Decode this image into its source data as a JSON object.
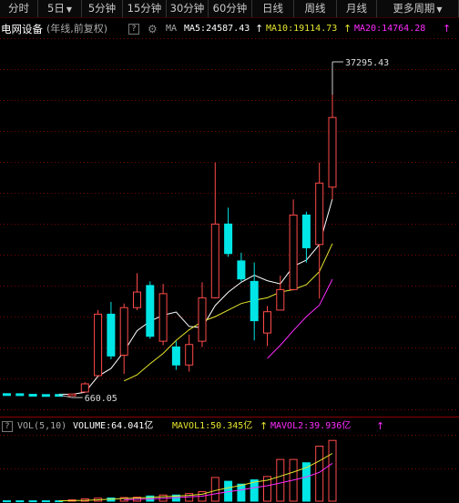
{
  "tabs": [
    {
      "label": "分时",
      "dropdown": false
    },
    {
      "label": "5日",
      "dropdown": true
    },
    {
      "label": "5分钟",
      "dropdown": false
    },
    {
      "label": "15分钟",
      "dropdown": false
    },
    {
      "label": "30分钟",
      "dropdown": false
    },
    {
      "label": "60分钟",
      "dropdown": false
    },
    {
      "label": "日线",
      "dropdown": false
    },
    {
      "label": "周线",
      "dropdown": false
    },
    {
      "label": "月线",
      "dropdown": false
    },
    {
      "label": "更多周期",
      "dropdown": true
    }
  ],
  "legend": {
    "title": "电网设备",
    "subtitle": "(年线,前复权)",
    "help": "?",
    "ma_label": "MA",
    "ma5": "MA5:24587.43",
    "ma10": "MA10:19114.73",
    "ma20": "MA20:14764.28",
    "up_arrow": "↑"
  },
  "price_labels": {
    "high": "37295.43",
    "low": "660.05"
  },
  "volume_legend": {
    "title": "VOL(5,10)",
    "volume": "VOLUME:64.041亿",
    "mavol1": "MAVOL1:50.345亿",
    "mavol2": "MAVOL2:39.936亿",
    "up_arrow": "↑"
  },
  "colors": {
    "up": "#ff4a4a",
    "down": "#00e5e5",
    "ma5": "#ffffff",
    "ma10": "#e6e62e",
    "ma20": "#ff2cff",
    "grid": "#7a0000"
  },
  "chart_data": {
    "type": "candlestick",
    "title": "电网设备",
    "series": [
      {
        "open": 800,
        "close": 760,
        "high": 820,
        "low": 740
      },
      {
        "open": 790,
        "close": 730,
        "high": 800,
        "low": 710
      },
      {
        "open": 720,
        "close": 690,
        "high": 730,
        "low": 680
      },
      {
        "open": 690,
        "close": 680,
        "high": 700,
        "low": 670
      },
      {
        "open": 700,
        "close": 660,
        "high": 710,
        "low": 660.05
      },
      {
        "open": 700,
        "close": 760,
        "high": 780,
        "low": 690
      },
      {
        "open": 1000,
        "close": 2000,
        "high": 2200,
        "low": 900
      },
      {
        "open": 3000,
        "close": 10500,
        "high": 11000,
        "low": 2900
      },
      {
        "open": 10500,
        "close": 5400,
        "high": 12000,
        "low": 5000
      },
      {
        "open": 5500,
        "close": 11300,
        "high": 11800,
        "low": 3200
      },
      {
        "open": 11300,
        "close": 13200,
        "high": 15500,
        "low": 11000
      },
      {
        "open": 14000,
        "close": 7800,
        "high": 14500,
        "low": 7500
      },
      {
        "open": 7200,
        "close": 13000,
        "high": 14200,
        "low": 6700
      },
      {
        "open": 6500,
        "close": 4300,
        "high": 7200,
        "low": 3700
      },
      {
        "open": 4300,
        "close": 6800,
        "high": 8000,
        "low": 3500
      },
      {
        "open": 7200,
        "close": 12500,
        "high": 14400,
        "low": 6500
      },
      {
        "open": 12500,
        "close": 21500,
        "high": 29000,
        "low": 12400
      },
      {
        "open": 21500,
        "close": 17900,
        "high": 23500,
        "low": 17500
      },
      {
        "open": 17000,
        "close": 14800,
        "high": 18000,
        "low": 14500
      },
      {
        "open": 14500,
        "close": 9700,
        "high": 16800,
        "low": 7300
      },
      {
        "open": 8200,
        "close": 10800,
        "high": 11500,
        "low": 6600
      },
      {
        "open": 11000,
        "close": 13500,
        "high": 15200,
        "low": 11000
      },
      {
        "open": 13500,
        "close": 22600,
        "high": 24500,
        "low": 13400
      },
      {
        "open": 22600,
        "close": 18600,
        "high": 23000,
        "low": 16800
      },
      {
        "open": 19000,
        "close": 26500,
        "high": 29000,
        "low": 12400
      },
      {
        "open": 26000,
        "close": 34500,
        "high": 37295.43,
        "low": 24500
      }
    ],
    "ma5": [
      null,
      null,
      null,
      null,
      742,
      724,
      966,
      2926,
      3876,
      5952,
      8480,
      9640,
      10380,
      10760,
      9000,
      8860,
      11560,
      13180,
      14400,
      15260,
      14580,
      14200,
      16340,
      17100,
      19000,
      24587.43
    ],
    "ma10": [
      null,
      null,
      null,
      null,
      null,
      null,
      null,
      null,
      null,
      2350,
      3100,
      4450,
      5700,
      7300,
      8600,
      9600,
      10200,
      11000,
      11800,
      12200,
      12500,
      13200,
      13500,
      14100,
      15700,
      19114.73
    ],
    "ma20": [
      null,
      null,
      null,
      null,
      null,
      null,
      null,
      null,
      null,
      null,
      null,
      null,
      null,
      null,
      null,
      null,
      null,
      null,
      null,
      null,
      5100,
      6700,
      8500,
      10200,
      11600,
      14764.28
    ],
    "volume": [
      0.4,
      0.4,
      0.4,
      0.4,
      0.4,
      1.5,
      2.5,
      3.2,
      3.4,
      3.8,
      4.2,
      5.5,
      6.5,
      6.5,
      8.0,
      10.0,
      25.0,
      21.0,
      18.0,
      22.5,
      26.0,
      44.0,
      44.0,
      40.5,
      58.0,
      64.041
    ],
    "mavol1": [
      null,
      null,
      null,
      null,
      0.4,
      0.6,
      0.8,
      1.4,
      2.1,
      2.9,
      3.4,
      4.0,
      4.7,
      5.4,
      6.1,
      7.3,
      11.2,
      14.1,
      16.7,
      20.1,
      22.1,
      26.3,
      30.7,
      35.4,
      42.5,
      50.345
    ],
    "mavol2": [
      null,
      null,
      null,
      null,
      null,
      null,
      null,
      null,
      null,
      1.5,
      1.9,
      2.4,
      3.0,
      3.7,
      4.5,
      5.3,
      7.8,
      10.0,
      11.9,
      14.3,
      16.3,
      19.2,
      22.3,
      25.5,
      30.4,
      39.936
    ],
    "ylim": [
      0,
      37295.43
    ],
    "volume_ylim": [
      0,
      70
    ],
    "grid": true
  }
}
